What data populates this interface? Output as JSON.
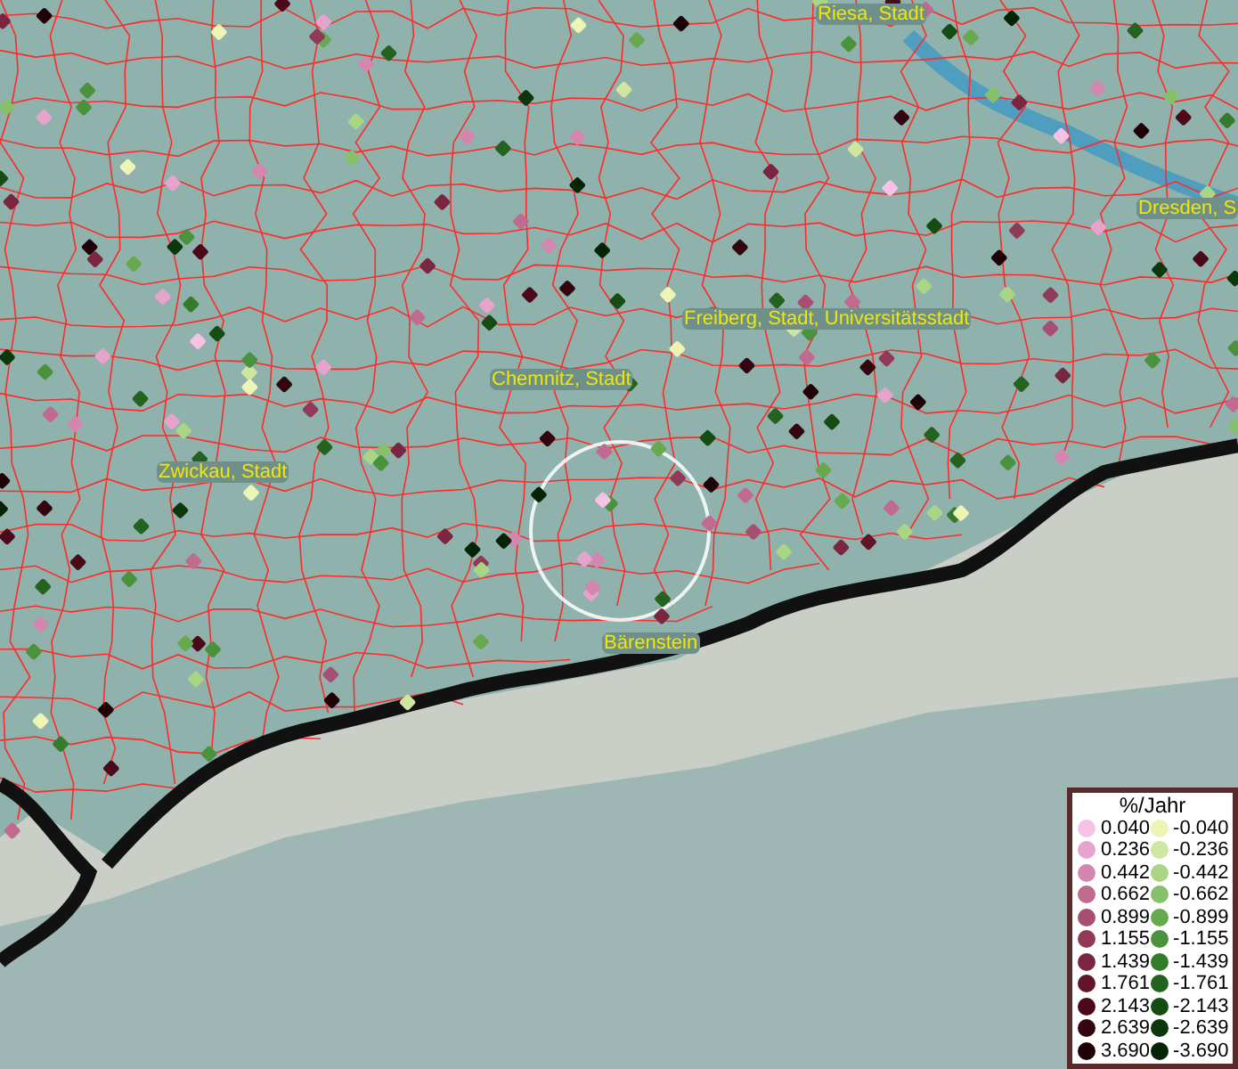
{
  "map": {
    "places": [
      {
        "name": "Riesa, Stadt"
      },
      {
        "name": "Dresden, S"
      },
      {
        "name": "Freiberg, Stadt, Universitätsstadt"
      },
      {
        "name": "Chemnitz, Stadt"
      },
      {
        "name": "Zwickau, Stadt"
      },
      {
        "name": "Bärenstein"
      }
    ]
  },
  "legend": {
    "title": "%/Jahr",
    "rows": [
      {
        "positive": {
          "label": "0.040",
          "color": "#f6c3e6"
        },
        "negative": {
          "label": "-0.040",
          "color": "#eef5b4"
        }
      },
      {
        "positive": {
          "label": "0.236",
          "color": "#e6a3cc"
        },
        "negative": {
          "label": "-0.236",
          "color": "#cfe6a0"
        }
      },
      {
        "positive": {
          "label": "0.442",
          "color": "#d487ae"
        },
        "negative": {
          "label": "-0.442",
          "color": "#a9d585"
        }
      },
      {
        "positive": {
          "label": "0.662",
          "color": "#c16a90"
        },
        "negative": {
          "label": "-0.662",
          "color": "#86c06a"
        }
      },
      {
        "positive": {
          "label": "0.899",
          "color": "#a84e72"
        },
        "negative": {
          "label": "-0.899",
          "color": "#66a94f"
        }
      },
      {
        "positive": {
          "label": "1.155",
          "color": "#913a58"
        },
        "negative": {
          "label": "-1.155",
          "color": "#4a923c"
        }
      },
      {
        "positive": {
          "label": "1.439",
          "color": "#7a2640"
        },
        "negative": {
          "label": "-1.439",
          "color": "#357b2c"
        }
      },
      {
        "positive": {
          "label": "1.761",
          "color": "#62142a"
        },
        "negative": {
          "label": "-1.761",
          "color": "#23631f"
        }
      },
      {
        "positive": {
          "label": "2.143",
          "color": "#4a0a1a"
        },
        "negative": {
          "label": "-2.143",
          "color": "#144c14"
        }
      },
      {
        "positive": {
          "label": "2.639",
          "color": "#33050f"
        },
        "negative": {
          "label": "-2.639",
          "color": "#0b370c"
        }
      },
      {
        "positive": {
          "label": "3.690",
          "color": "#1e0207"
        },
        "negative": {
          "label": "-3.690",
          "color": "#052406"
        }
      }
    ]
  }
}
